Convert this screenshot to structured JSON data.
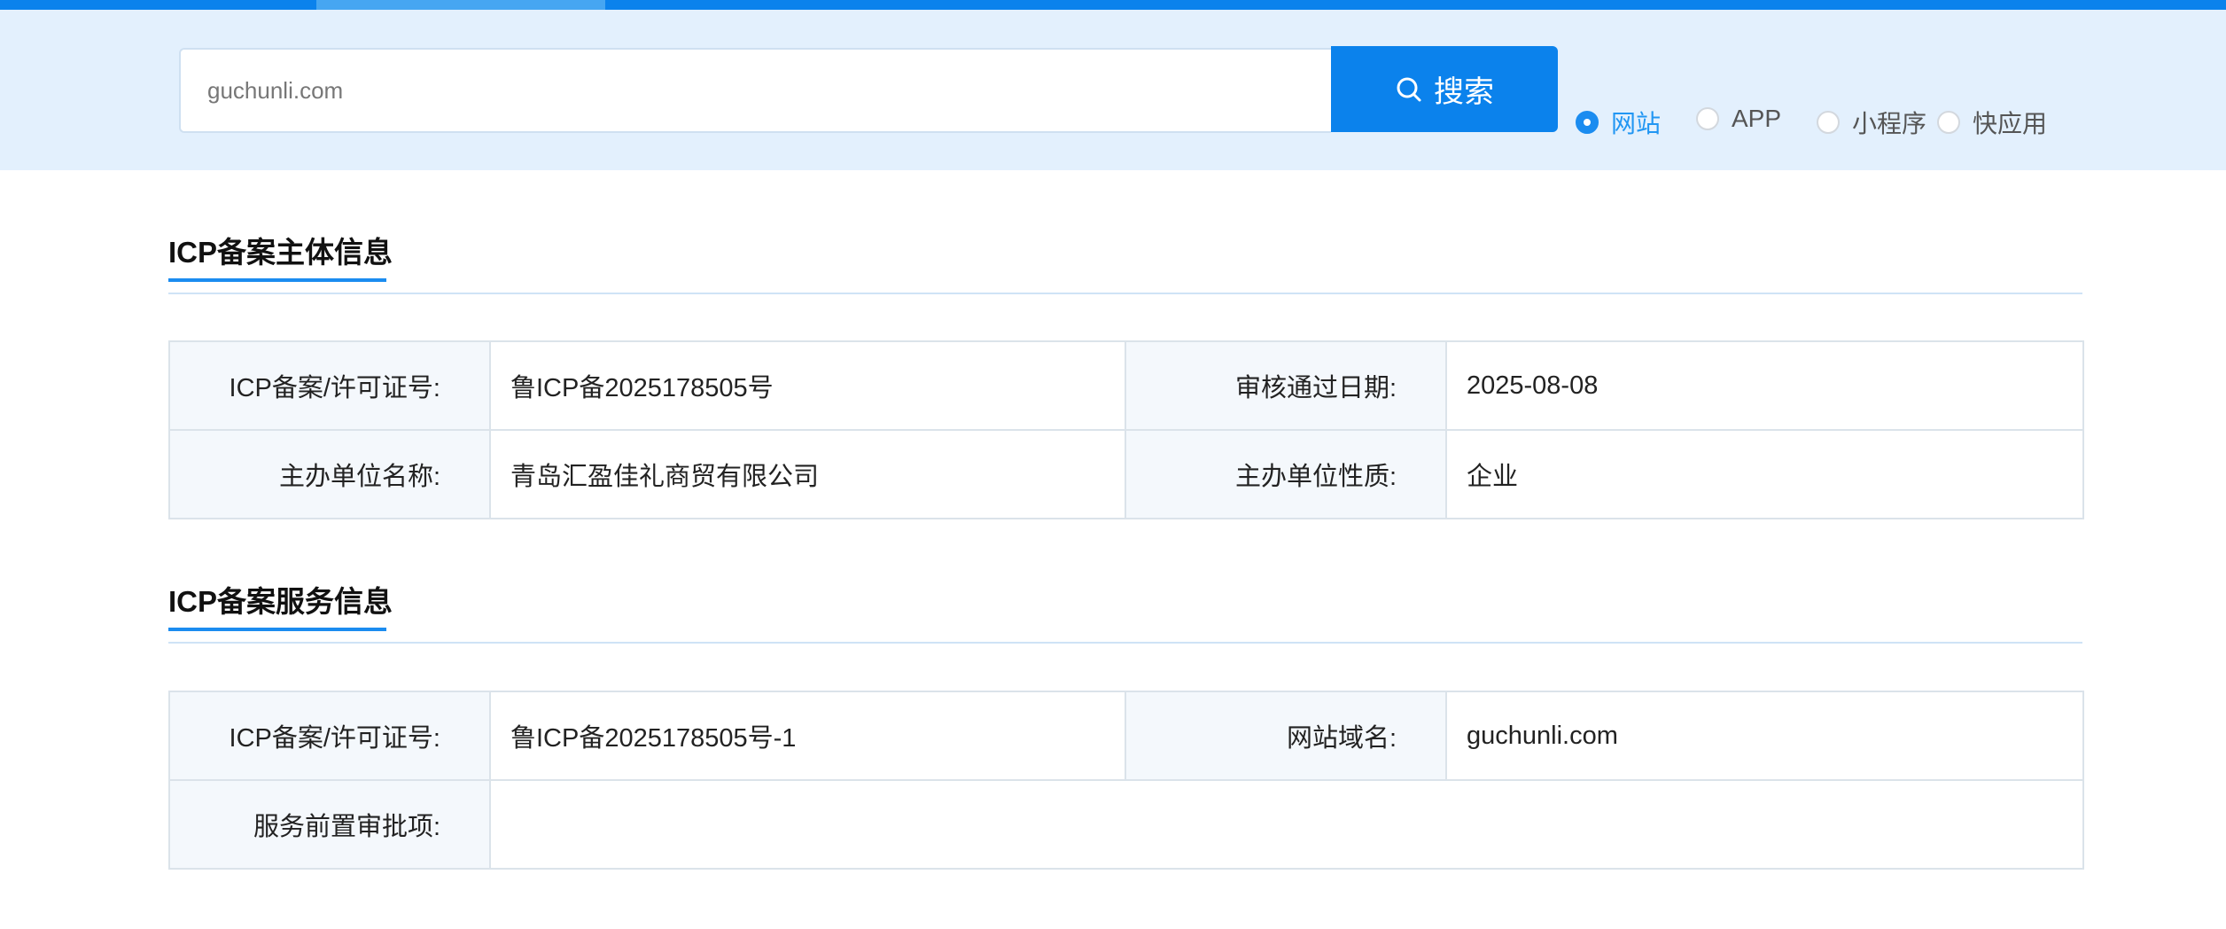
{
  "search": {
    "value": "guchunli.com",
    "button_label": "搜索",
    "types": [
      {
        "label": "网站",
        "checked": true
      },
      {
        "label": "APP",
        "checked": false
      },
      {
        "label": "小程序",
        "checked": false
      },
      {
        "label": "快应用",
        "checked": false
      }
    ]
  },
  "subject_info": {
    "title": "ICP备案主体信息",
    "rows": [
      {
        "label1": "ICP备案/许可证号:",
        "value1": "鲁ICP备2025178505号",
        "label2": "审核通过日期:",
        "value2": "2025-08-08"
      },
      {
        "label1": "主办单位名称:",
        "value1": "青岛汇盈佳礼商贸有限公司",
        "label2": "主办单位性质:",
        "value2": "企业"
      }
    ]
  },
  "service_info": {
    "title": "ICP备案服务信息",
    "rows": [
      {
        "label1": "ICP备案/许可证号:",
        "value1": "鲁ICP备2025178505号-1",
        "label2": "网站域名:",
        "value2": "guchunli.com"
      },
      {
        "label1": "服务前置审批项:",
        "value1": ""
      }
    ]
  },
  "colors": {
    "accent": "#0b82ec",
    "band": "#e3f0fd",
    "label_bg": "#f4f8fc"
  },
  "icons": {
    "search": "search-icon"
  }
}
